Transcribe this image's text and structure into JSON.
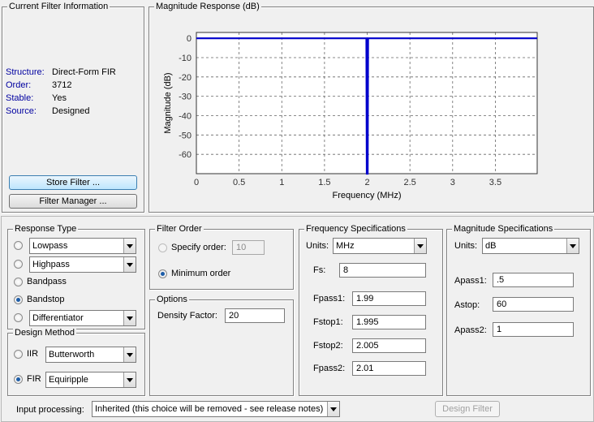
{
  "filter_info": {
    "title": "Current Filter Information",
    "rows": [
      {
        "label": "Structure:",
        "value": "Direct-Form FIR"
      },
      {
        "label": "Order:",
        "value": "3712"
      },
      {
        "label": "Stable:",
        "value": "Yes"
      },
      {
        "label": "Source:",
        "value": "Designed"
      }
    ],
    "store_button": "Store Filter ...",
    "manager_button": "Filter Manager ..."
  },
  "chart_title": "Magnitude Response (dB)",
  "chart_data": {
    "type": "line",
    "xlabel": "Frequency (MHz)",
    "ylabel": "Magnitude (dB)",
    "xlim": [
      0,
      3.99
    ],
    "ylim": [
      -70,
      3
    ],
    "xticks": [
      "0",
      "0.5",
      "1",
      "1.5",
      "2",
      "2.5",
      "3",
      "3.5"
    ],
    "yticks": [
      "0",
      "-10",
      "-20",
      "-30",
      "-40",
      "-50",
      "-60"
    ],
    "grid": true,
    "series": [
      {
        "color": "#0000cc",
        "x": [
          0,
          1.99,
          1.995,
          2.0,
          2.005,
          2.01,
          3.99
        ],
        "y": [
          0,
          0,
          -70,
          -70,
          -70,
          0,
          0
        ]
      }
    ]
  },
  "response_type": {
    "title": "Response Type",
    "options": [
      {
        "label": "Lowpass",
        "type": "select",
        "checked": false
      },
      {
        "label": "Highpass",
        "type": "select",
        "checked": false
      },
      {
        "label": "Bandpass",
        "type": "label",
        "checked": false
      },
      {
        "label": "Bandstop",
        "type": "label",
        "checked": true
      },
      {
        "label": "Differentiator",
        "type": "select",
        "checked": false
      }
    ]
  },
  "design_method": {
    "title": "Design Method",
    "iir_label": "IIR",
    "iir_value": "Butterworth",
    "fir_label": "FIR",
    "fir_value": "Equiripple",
    "selected": "FIR"
  },
  "filter_order": {
    "title": "Filter Order",
    "specify_label": "Specify order:",
    "specify_value": "10",
    "minimum_label": "Minimum order",
    "selected": "minimum"
  },
  "options": {
    "title": "Options",
    "density_label": "Density Factor:",
    "density_value": "20"
  },
  "frequency_specs": {
    "title": "Frequency Specifications",
    "units_label": "Units:",
    "units_value": "MHz",
    "fields": [
      {
        "label": "Fs:",
        "value": "8"
      },
      {
        "label": "Fpass1:",
        "value": "1.99"
      },
      {
        "label": "Fstop1:",
        "value": "1.995"
      },
      {
        "label": "Fstop2:",
        "value": "2.005"
      },
      {
        "label": "Fpass2:",
        "value": "2.01"
      }
    ]
  },
  "magnitude_specs": {
    "title": "Magnitude Specifications",
    "units_label": "Units:",
    "units_value": "dB",
    "fields": [
      {
        "label": "Apass1:",
        "value": ".5"
      },
      {
        "label": "Astop:",
        "value": "60"
      },
      {
        "label": "Apass2:",
        "value": "1"
      }
    ]
  },
  "bottom": {
    "input_processing_label": "Input processing:",
    "input_processing_value": "Inherited (this choice will be removed - see release notes)",
    "design_button": "Design Filter"
  },
  "colors": {
    "label_blue": "#0000a0",
    "plot_line": "#0000cc"
  }
}
